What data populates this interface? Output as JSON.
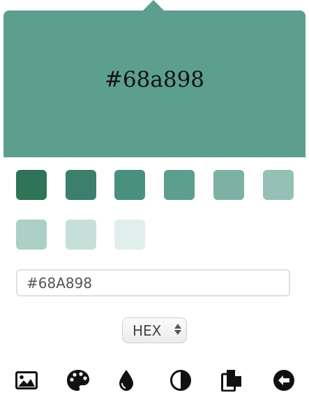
{
  "preview": {
    "color_hex": "#5d9f8e",
    "label": "#68a898"
  },
  "swatches": [
    {
      "color": "#2f7359"
    },
    {
      "color": "#3b7f6c"
    },
    {
      "color": "#4a907e"
    },
    {
      "color": "#5d9f8e"
    },
    {
      "color": "#7cb1a3"
    },
    {
      "color": "#94c0b5"
    },
    {
      "color": "#acd0c6"
    },
    {
      "color": "#c6e0d9"
    },
    {
      "color": "#e0efec"
    }
  ],
  "hex_input": {
    "value": "#68A898"
  },
  "format_select": {
    "selected": "HEX"
  },
  "toolbar": [
    {
      "icon": "image-icon"
    },
    {
      "icon": "palette-icon"
    },
    {
      "icon": "drop-icon"
    },
    {
      "icon": "contrast-icon"
    },
    {
      "icon": "copy-icon"
    },
    {
      "icon": "back-arrow-icon"
    }
  ]
}
